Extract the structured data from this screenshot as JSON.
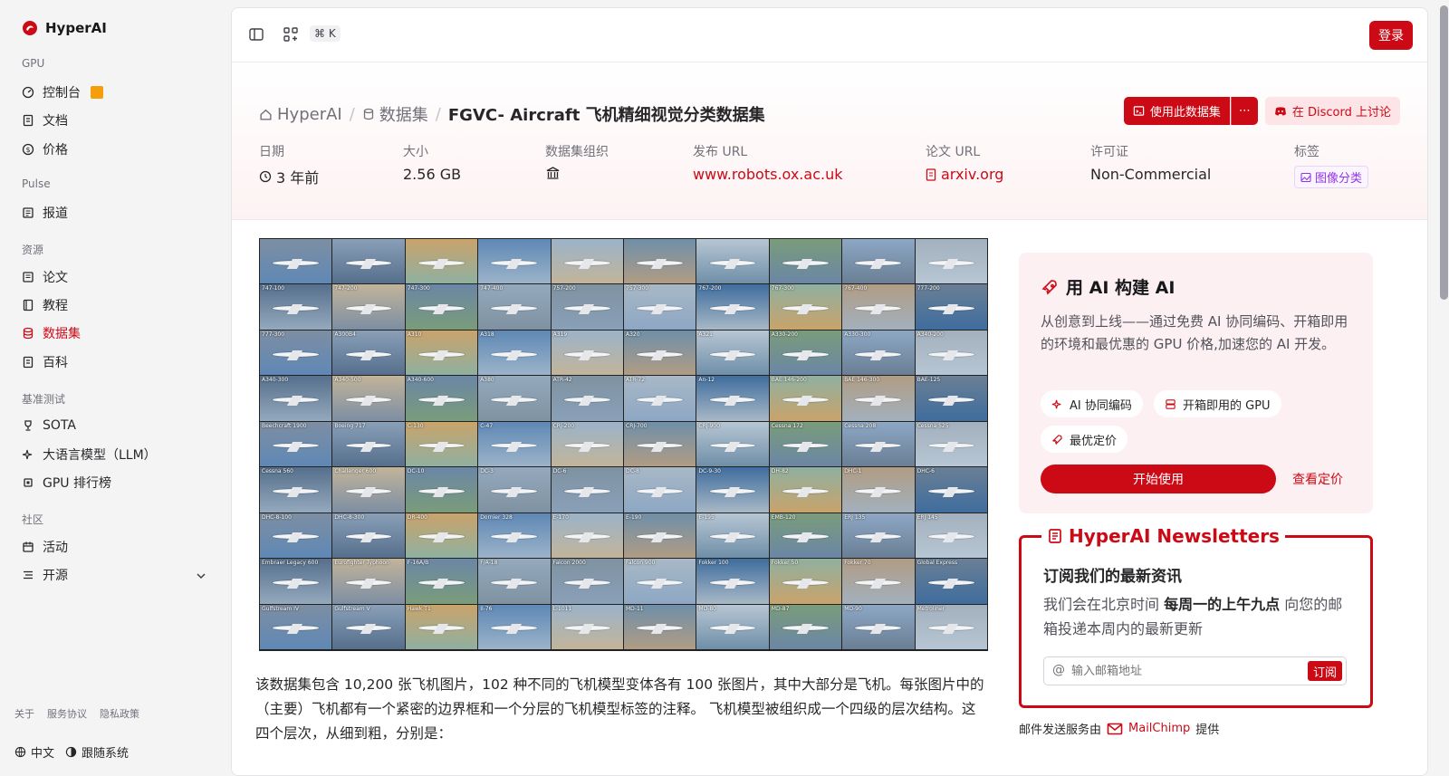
{
  "brand": {
    "name": "HyperAI"
  },
  "sidebar": {
    "sections": [
      {
        "title": "GPU",
        "items": [
          {
            "label": "控制台",
            "icon": "gauge-icon"
          },
          {
            "label": "文档",
            "icon": "doc-icon"
          },
          {
            "label": "价格",
            "icon": "dollar-icon"
          }
        ]
      },
      {
        "title": "Pulse",
        "items": [
          {
            "label": "报道",
            "icon": "newspaper-icon"
          }
        ]
      },
      {
        "title": "资源",
        "items": [
          {
            "label": "论文",
            "icon": "paper-icon"
          },
          {
            "label": "教程",
            "icon": "book-icon"
          },
          {
            "label": "数据集",
            "icon": "database-icon"
          },
          {
            "label": "百科",
            "icon": "wiki-icon"
          }
        ]
      },
      {
        "title": "基准测试",
        "items": [
          {
            "label": "SOTA",
            "icon": "trophy-icon"
          },
          {
            "label": "大语言模型（LLM）",
            "icon": "sparkles-icon"
          },
          {
            "label": "GPU 排行榜",
            "icon": "chip-icon"
          }
        ]
      },
      {
        "title": "社区",
        "items": [
          {
            "label": "活动",
            "icon": "calendar-icon"
          },
          {
            "label": "开源",
            "icon": "list-icon"
          }
        ]
      }
    ],
    "footer_links": [
      "关于",
      "服务协议",
      "隐私政策"
    ],
    "language": "中文",
    "theme": "跟随系统"
  },
  "topbar": {
    "shortcut": "⌘ K",
    "login": "登录"
  },
  "breadcrumb": {
    "home": "HyperAI",
    "section": "数据集",
    "current": "FGVC- Aircraft 飞机精细视觉分类数据集"
  },
  "actions": {
    "use": "使用此数据集",
    "more": "⋯",
    "discord": "在 Discord 上讨论"
  },
  "meta": {
    "date": {
      "label": "日期",
      "value": "3 年前"
    },
    "size": {
      "label": "大小",
      "value": "2.56 GB"
    },
    "org": {
      "label": "数据集组织"
    },
    "release": {
      "label": "发布 URL",
      "value": "www.robots.ox.ac.uk"
    },
    "paper": {
      "label": "论文 URL",
      "value": "arxiv.org"
    },
    "license": {
      "label": "许可证",
      "value": "Non-Commercial"
    },
    "tags": {
      "label": "标签",
      "value": "图像分类"
    }
  },
  "grid_labels": [
    "",
    "",
    "",
    "",
    "",
    "",
    "",
    "",
    "",
    "",
    "747-100",
    "747-200",
    "747-300",
    "747-400",
    "757-200",
    "757-300",
    "767-200",
    "767-300",
    "767-400",
    "777-200",
    "777-300",
    "A300B4",
    "A310",
    "A318",
    "A319",
    "A320",
    "A321",
    "A330-200",
    "A330-300",
    "A340-200",
    "A340-300",
    "A340-500",
    "A340-600",
    "A380",
    "ATR-42",
    "ATR-72",
    "An-12",
    "BAE 146-200",
    "BAE 146-300",
    "BAE-125",
    "Beechcraft 1900",
    "Boeing 717",
    "C-130",
    "C-47",
    "CRJ-200",
    "CRJ-700",
    "CRJ-900",
    "Cessna 172",
    "Cessna 208",
    "Cessna 525",
    "Cessna 560",
    "Challenger 600",
    "DC-10",
    "DC-3",
    "DC-6",
    "DC-8",
    "DC-9-30",
    "DH-82",
    "DHC-1",
    "DHC-6",
    "DHC-8-100",
    "DHC-8-300",
    "DR-400",
    "Dornier 328",
    "E-170",
    "E-190",
    "E-195",
    "EMB-120",
    "ERJ 135",
    "ERJ 145",
    "Embraer Legacy 600",
    "Eurofighter Typhoon",
    "F-16A/B",
    "F/A-18",
    "Falcon 2000",
    "Falcon 900",
    "Fokker 100",
    "Fokker 50",
    "Fokker 70",
    "Global Express",
    "Gulfstream IV",
    "Gulfstream V",
    "Hawk T1",
    "Il-76",
    "L-1011",
    "MD-11",
    "MD-80",
    "MD-87",
    "MD-90",
    "Metroliner",
    "Model B200",
    "PA-28",
    "SR-20",
    "Saab 2000",
    "Saab 340",
    "Spitfire",
    "Tornado",
    "Tu-134",
    "Tu-154",
    "Yak-42"
  ],
  "description": "该数据集包含 10,200 张飞机图片，102 种不同的飞机模型变体各有 100 张图片，其中大部分是飞机。每张图片中的（主要）飞机都有一个紧密的边界框和一个分层的飞机模型标签的注释。 飞机模型被组织成一个四级的层次结构。这四个层次，从细到粗，分别是：",
  "promo": {
    "title": "用 AI 构建 AI",
    "body": "从创意到上线——通过免费 AI 协同编码、开箱即用的环境和最优惠的 GPU 价格,加速您的 AI 开发。",
    "chips": [
      "AI 协同编码",
      "开箱即用的 GPU",
      "最优定价"
    ],
    "start": "开始使用",
    "pricing": "查看定价"
  },
  "newsletter": {
    "legend": "HyperAI Newsletters",
    "title": "订阅我们的最新资讯",
    "desc_pre": "我们会在北京时间 ",
    "desc_bold": "每周一的上午九点",
    "desc_post": " 向您的邮箱投递本周内的最新更新",
    "placeholder": "输入邮箱地址",
    "subscribe": "订阅",
    "credit_pre": "邮件发送服务由",
    "credit_brand": "MailChimp",
    "credit_post": "提供"
  },
  "colors": {
    "accent": "#cc0a16"
  }
}
